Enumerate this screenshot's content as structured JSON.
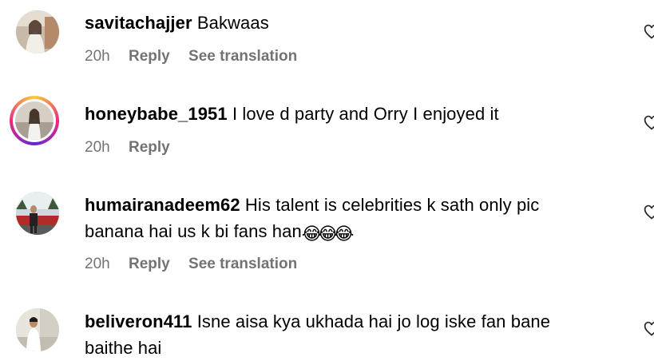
{
  "comments": [
    {
      "username": "savitachajjer",
      "text": "Bakwaas",
      "time": "20h",
      "reply": "Reply",
      "translation": "See translation",
      "avatar": "avatar-photo",
      "story_ring": false
    },
    {
      "username": "honeybabe_1951",
      "text": "I love d party and Orry I enjoyed it",
      "time": "20h",
      "reply": "Reply",
      "translation": "",
      "avatar": "avatar-photo",
      "story_ring": true
    },
    {
      "username": "humairanadeem62",
      "text_line1": "His talent is celebrities k sath only pic",
      "text_line2": "banana hai us k bi fans han",
      "emojis": [
        "😂",
        "😂",
        "😂"
      ],
      "time": "20h",
      "reply": "Reply",
      "translation": "See translation",
      "avatar": "avatar-photo",
      "story_ring": false
    },
    {
      "username": "beliveron411",
      "text_line1": "Isne aisa kya ukhada hai jo log iske fan bane",
      "text_line2": "baithe hai",
      "avatar": "avatar-photo",
      "story_ring": false
    }
  ],
  "icons": {
    "like": "heart-outline-icon"
  },
  "colors": {
    "meta": "#737373",
    "story_ring": [
      "#f9ce34",
      "#ee2a7b",
      "#6228d7"
    ]
  }
}
